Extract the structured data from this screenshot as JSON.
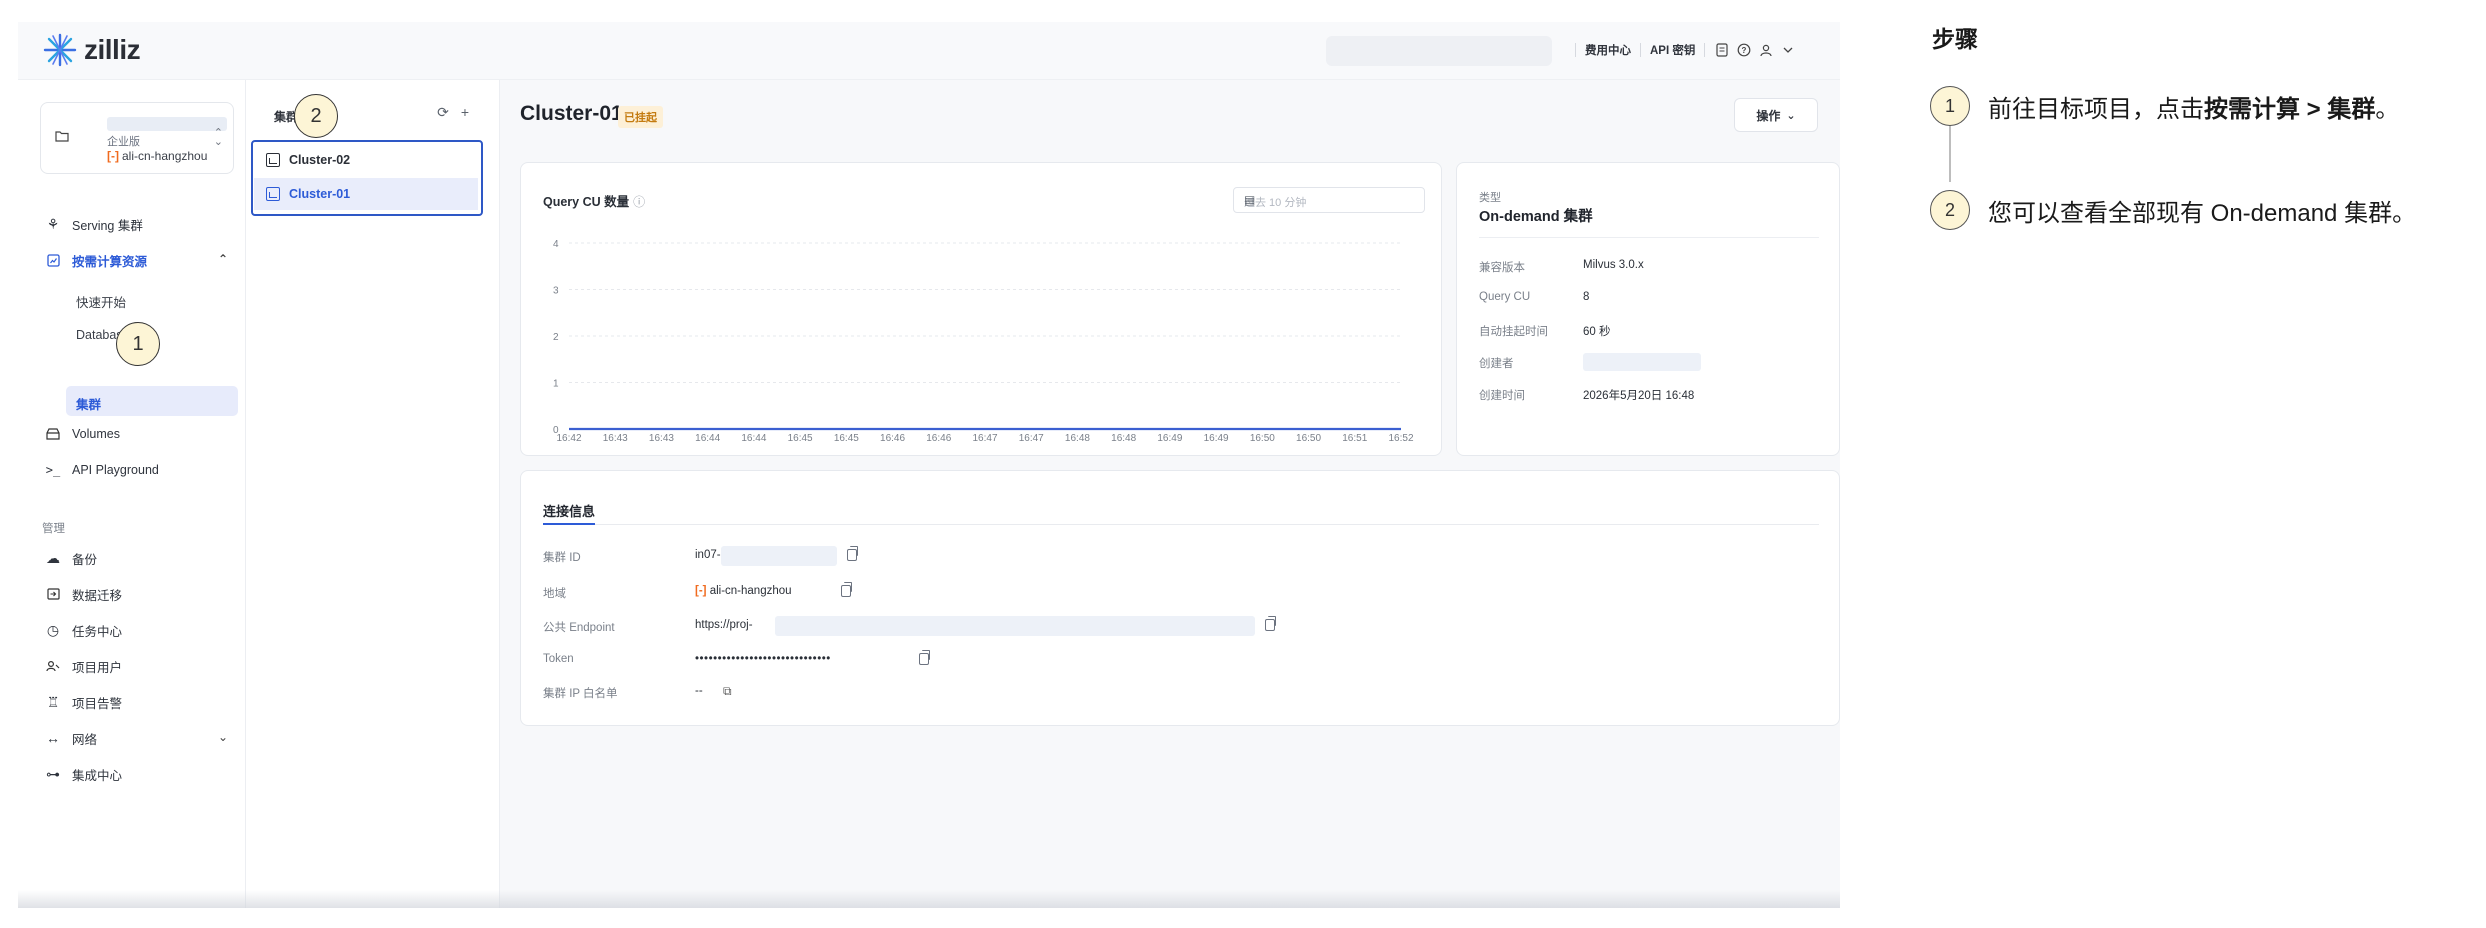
{
  "topbar": {
    "logo_text": "zilliz",
    "links": [
      "费用中心",
      "API 密钥"
    ]
  },
  "sidebar": {
    "org": {
      "plan": "企业版",
      "region": "ali-cn-hangzhou"
    },
    "items": [
      {
        "label": "Serving 集群",
        "icon": "serving-icon"
      },
      {
        "label": "按需计算资源",
        "icon": "ondemand-icon"
      },
      {
        "label": "Volumes",
        "icon": "volumes-icon"
      },
      {
        "label": "API Playground",
        "icon": "terminal-icon"
      }
    ],
    "subitems": [
      "快速开始",
      "Database",
      "集群"
    ],
    "group_label": "管理",
    "manage_items": [
      {
        "label": "备份",
        "icon": "cloud-backup-icon"
      },
      {
        "label": "数据迁移",
        "icon": "migration-icon"
      },
      {
        "label": "任务中心",
        "icon": "history-icon"
      },
      {
        "label": "项目用户",
        "icon": "users-icon"
      },
      {
        "label": "项目告警",
        "icon": "alarm-icon"
      },
      {
        "label": "网络",
        "icon": "network-icon"
      },
      {
        "label": "集成中心",
        "icon": "integration-icon"
      }
    ]
  },
  "cluster_list": {
    "title": "集群",
    "clusters": [
      "Cluster-02",
      "Cluster-01"
    ],
    "selected": "Cluster-01"
  },
  "main": {
    "title": "Cluster-01",
    "status_badge": "已挂起",
    "ops_button": "操作",
    "chart_card": {
      "title": "Query CU 数量",
      "time_placeholder": "过去 10 分钟"
    },
    "info": {
      "type_label": "类型",
      "type_value": "On-demand 集群",
      "rows": [
        {
          "k": "兼容版本",
          "v": "Milvus 3.0.x"
        },
        {
          "k": "Query CU",
          "v": "8"
        },
        {
          "k": "自动挂起时间",
          "v": "60 秒"
        },
        {
          "k": "创建者",
          "v": ""
        },
        {
          "k": "创建时间",
          "v": "2026年5月20日 16:48"
        }
      ]
    },
    "connection": {
      "tab": "连接信息",
      "rows": [
        {
          "k": "集群 ID",
          "v": "in07-"
        },
        {
          "k": "地域",
          "v": "ali-cn-hangzhou"
        },
        {
          "k": "公共 Endpoint",
          "v": "https://proj-"
        },
        {
          "k": "Token",
          "v": "••••••••••••••••••••••••••••••"
        },
        {
          "k": "集群 IP 白名单",
          "v": "--"
        }
      ]
    }
  },
  "chart_data": {
    "type": "line",
    "title": "Query CU 数量",
    "x": [
      "16:42",
      "16:43",
      "16:43",
      "16:44",
      "16:44",
      "16:45",
      "16:45",
      "16:46",
      "16:46",
      "16:47",
      "16:47",
      "16:48",
      "16:48",
      "16:49",
      "16:49",
      "16:50",
      "16:50",
      "16:51",
      "16:52"
    ],
    "series": [
      {
        "values": [
          0,
          0,
          0,
          0,
          0,
          0,
          0,
          0,
          0,
          0,
          0,
          0,
          0,
          0,
          0,
          0,
          0,
          0,
          0
        ]
      }
    ],
    "yticks": [
      0,
      1,
      2,
      3,
      4
    ],
    "ylim": [
      0,
      4
    ],
    "grid": true,
    "line_color": "#3b5fd1"
  },
  "annotations": {
    "step1": "1",
    "step2": "2"
  },
  "guide": {
    "title": "步骤",
    "steps": [
      {
        "num": "1",
        "pre": "前往目标项目，点击",
        "bold": "按需计算 > 集群",
        "post": "。"
      },
      {
        "num": "2",
        "pre": "您可以查看全部现有 On-demand 集群。",
        "bold": "",
        "post": ""
      }
    ]
  }
}
